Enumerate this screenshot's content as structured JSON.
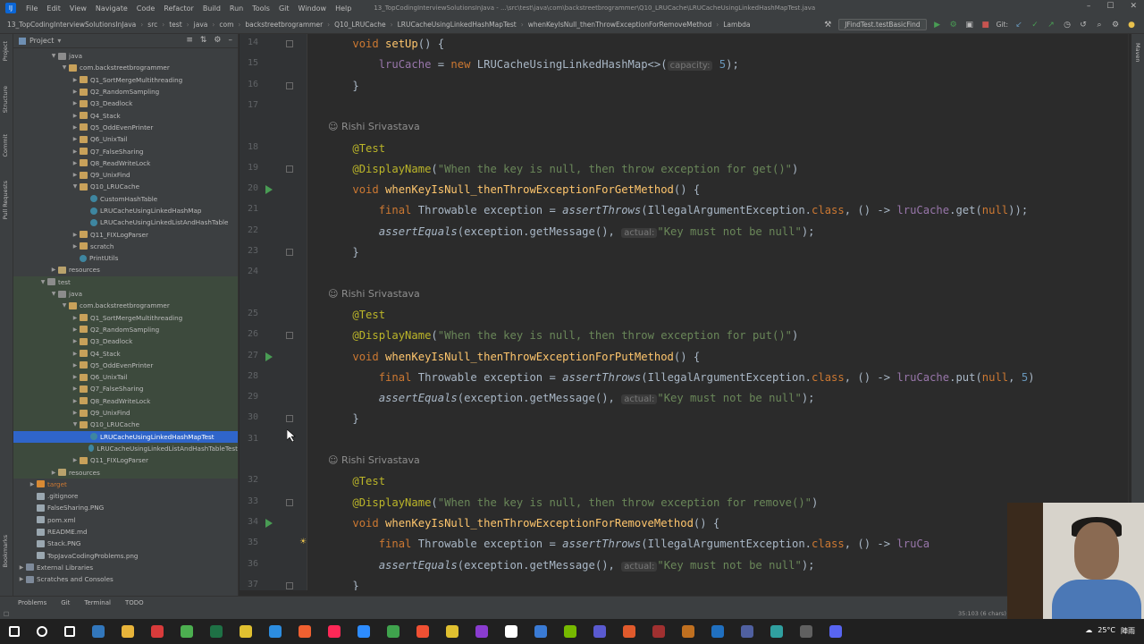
{
  "app": {
    "menu": [
      "File",
      "Edit",
      "View",
      "Navigate",
      "Code",
      "Refactor",
      "Build",
      "Run",
      "Tools",
      "Git",
      "Window",
      "Help"
    ],
    "window_title": "13_TopCodingInterviewSolutionsInJava - ...\\src\\test\\java\\com\\backstreetbrogrammer\\Q10_LRUCache\\LRUCacheUsingLinkedHashMapTest.java"
  },
  "breadcrumbs": [
    "13_TopCodingInterviewSolutionsInJava",
    "src",
    "test",
    "java",
    "com",
    "backstreetbrogrammer",
    "Q10_LRUCache",
    "LRUCacheUsingLinkedHashMapTest",
    "whenKeyIsNull_thenThrowExceptionForRemoveMethod",
    "Lambda"
  ],
  "run_config": "JFindTest.testBasicFind",
  "git_label": "Git:",
  "project_panel": {
    "title": "Project",
    "tree": [
      {
        "label": "java",
        "depth": 3,
        "kind": "folder",
        "state": "open",
        "tint": ""
      },
      {
        "label": "com.backstreetbrogrammer",
        "depth": 4,
        "kind": "pkg",
        "state": "open",
        "tint": ""
      },
      {
        "label": "Q1_SortMergeMultithreading",
        "depth": 5,
        "kind": "pkg",
        "state": "closed",
        "tint": ""
      },
      {
        "label": "Q2_RandomSampling",
        "depth": 5,
        "kind": "pkg",
        "state": "closed",
        "tint": ""
      },
      {
        "label": "Q3_Deadlock",
        "depth": 5,
        "kind": "pkg",
        "state": "closed",
        "tint": ""
      },
      {
        "label": "Q4_Stack",
        "depth": 5,
        "kind": "pkg",
        "state": "closed",
        "tint": ""
      },
      {
        "label": "Q5_OddEvenPrinter",
        "depth": 5,
        "kind": "pkg",
        "state": "closed",
        "tint": ""
      },
      {
        "label": "Q6_UnixTail",
        "depth": 5,
        "kind": "pkg",
        "state": "closed",
        "tint": ""
      },
      {
        "label": "Q7_FalseSharing",
        "depth": 5,
        "kind": "pkg",
        "state": "closed",
        "tint": ""
      },
      {
        "label": "Q8_ReadWriteLock",
        "depth": 5,
        "kind": "pkg",
        "state": "closed",
        "tint": ""
      },
      {
        "label": "Q9_UnixFind",
        "depth": 5,
        "kind": "pkg",
        "state": "closed",
        "tint": ""
      },
      {
        "label": "Q10_LRUCache",
        "depth": 5,
        "kind": "pkg",
        "state": "open",
        "tint": ""
      },
      {
        "label": "CustomHashTable",
        "depth": 6,
        "kind": "cls",
        "state": "",
        "tint": ""
      },
      {
        "label": "LRUCacheUsingLinkedHashMap",
        "depth": 6,
        "kind": "cls",
        "state": "",
        "tint": ""
      },
      {
        "label": "LRUCacheUsingLinkedListAndHashTable",
        "depth": 6,
        "kind": "cls",
        "state": "",
        "tint": ""
      },
      {
        "label": "Q11_FIXLogParser",
        "depth": 5,
        "kind": "pkg",
        "state": "closed",
        "tint": ""
      },
      {
        "label": "scratch",
        "depth": 5,
        "kind": "pkg",
        "state": "closed",
        "tint": ""
      },
      {
        "label": "PrintUtils",
        "depth": 5,
        "kind": "cls",
        "state": "",
        "tint": ""
      },
      {
        "label": "resources",
        "depth": 3,
        "kind": "res",
        "state": "closed",
        "tint": ""
      },
      {
        "label": "test",
        "depth": 2,
        "kind": "folder",
        "state": "open",
        "tint": "green"
      },
      {
        "label": "java",
        "depth": 3,
        "kind": "folder",
        "state": "open",
        "tint": "green"
      },
      {
        "label": "com.backstreetbrogrammer",
        "depth": 4,
        "kind": "pkg",
        "state": "open",
        "tint": "green"
      },
      {
        "label": "Q1_SortMergeMultithreading",
        "depth": 5,
        "kind": "pkg",
        "state": "closed",
        "tint": "green"
      },
      {
        "label": "Q2_RandomSampling",
        "depth": 5,
        "kind": "pkg",
        "state": "closed",
        "tint": "green"
      },
      {
        "label": "Q3_Deadlock",
        "depth": 5,
        "kind": "pkg",
        "state": "closed",
        "tint": "green"
      },
      {
        "label": "Q4_Stack",
        "depth": 5,
        "kind": "pkg",
        "state": "closed",
        "tint": "green"
      },
      {
        "label": "Q5_OddEvenPrinter",
        "depth": 5,
        "kind": "pkg",
        "state": "closed",
        "tint": "green"
      },
      {
        "label": "Q6_UnixTail",
        "depth": 5,
        "kind": "pkg",
        "state": "closed",
        "tint": "green"
      },
      {
        "label": "Q7_FalseSharing",
        "depth": 5,
        "kind": "pkg",
        "state": "closed",
        "tint": "green"
      },
      {
        "label": "Q8_ReadWriteLock",
        "depth": 5,
        "kind": "pkg",
        "state": "closed",
        "tint": "green"
      },
      {
        "label": "Q9_UnixFind",
        "depth": 5,
        "kind": "pkg",
        "state": "closed",
        "tint": "green"
      },
      {
        "label": "Q10_LRUCache",
        "depth": 5,
        "kind": "pkg",
        "state": "open",
        "tint": "green"
      },
      {
        "label": "LRUCacheUsingLinkedHashMapTest",
        "depth": 6,
        "kind": "cls",
        "state": "",
        "tint": "selected"
      },
      {
        "label": "LRUCacheUsingLinkedListAndHashTableTest",
        "depth": 6,
        "kind": "cls",
        "state": "",
        "tint": "green"
      },
      {
        "label": "Q11_FIXLogParser",
        "depth": 5,
        "kind": "pkg",
        "state": "closed",
        "tint": "green"
      },
      {
        "label": "resources",
        "depth": 3,
        "kind": "res",
        "state": "closed",
        "tint": "green"
      },
      {
        "label": "target",
        "depth": 1,
        "kind": "target",
        "state": "closed",
        "tint": "target"
      },
      {
        "label": ".gitignore",
        "depth": 1,
        "kind": "file",
        "state": "",
        "tint": ""
      },
      {
        "label": "FalseSharing.PNG",
        "depth": 1,
        "kind": "file",
        "state": "",
        "tint": ""
      },
      {
        "label": "pom.xml",
        "depth": 1,
        "kind": "file",
        "state": "",
        "tint": ""
      },
      {
        "label": "README.md",
        "depth": 1,
        "kind": "file",
        "state": "",
        "tint": ""
      },
      {
        "label": "Stack.PNG",
        "depth": 1,
        "kind": "file",
        "state": "",
        "tint": ""
      },
      {
        "label": "TopJavaCodingProblems.png",
        "depth": 1,
        "kind": "file",
        "state": "",
        "tint": ""
      },
      {
        "label": "External Libraries",
        "depth": 0,
        "kind": "lib",
        "state": "closed",
        "tint": ""
      },
      {
        "label": "Scratches and Consoles",
        "depth": 0,
        "kind": "lib",
        "state": "closed",
        "tint": ""
      }
    ]
  },
  "editor": {
    "lines": [
      {
        "n": "14",
        "run": false,
        "fold": true,
        "bulb": false,
        "author": "",
        "tokens": [
          [
            "    ",
            ""
          ],
          [
            "void ",
            "kw"
          ],
          [
            "setUp",
            "fn"
          ],
          [
            "() {",
            ""
          ]
        ]
      },
      {
        "n": "15",
        "run": false,
        "fold": false,
        "bulb": false,
        "author": "",
        "tokens": [
          [
            "        ",
            ""
          ],
          [
            "lruCache",
            "fld"
          ],
          [
            " = ",
            ""
          ],
          [
            "new ",
            "kw"
          ],
          [
            "LRUCacheUsingLinkedHashMap<>(",
            ""
          ],
          [
            "capacity:",
            "hint"
          ],
          [
            " 5",
            "num"
          ],
          [
            ");",
            ""
          ]
        ]
      },
      {
        "n": "16",
        "run": false,
        "fold": true,
        "bulb": false,
        "author": "",
        "tokens": [
          [
            "    }",
            ""
          ]
        ]
      },
      {
        "n": "17",
        "run": false,
        "fold": false,
        "bulb": false,
        "author": "",
        "tokens": []
      },
      {
        "n": "",
        "run": false,
        "fold": false,
        "bulb": false,
        "author": "Rishi Srivastava",
        "tokens": []
      },
      {
        "n": "18",
        "run": false,
        "fold": false,
        "bulb": false,
        "author": "",
        "tokens": [
          [
            "    ",
            ""
          ],
          [
            "@Test",
            "ann"
          ]
        ]
      },
      {
        "n": "19",
        "run": false,
        "fold": true,
        "bulb": false,
        "author": "",
        "tokens": [
          [
            "    ",
            ""
          ],
          [
            "@DisplayName",
            "ann"
          ],
          [
            "(",
            ""
          ],
          [
            "\"When the key is null, then throw exception for get()\"",
            "str"
          ],
          [
            ")",
            ""
          ]
        ]
      },
      {
        "n": "20",
        "run": true,
        "fold": false,
        "bulb": false,
        "author": "",
        "tokens": [
          [
            "    ",
            ""
          ],
          [
            "void ",
            "kw"
          ],
          [
            "whenKeyIsNull_thenThrowExceptionForGetMethod",
            "fn"
          ],
          [
            "() {",
            ""
          ]
        ]
      },
      {
        "n": "21",
        "run": false,
        "fold": false,
        "bulb": false,
        "author": "",
        "tokens": [
          [
            "        ",
            ""
          ],
          [
            "final ",
            "kw"
          ],
          [
            "Throwable exception = ",
            ""
          ],
          [
            "assertThrows",
            "it"
          ],
          [
            "(IllegalArgumentException.",
            ""
          ],
          [
            "class",
            "kw"
          ],
          [
            ", () -> ",
            ""
          ],
          [
            "lruCache",
            "fld"
          ],
          [
            ".get(",
            ""
          ],
          [
            "null",
            "kw"
          ],
          [
            "));",
            ""
          ]
        ]
      },
      {
        "n": "22",
        "run": false,
        "fold": false,
        "bulb": false,
        "author": "",
        "tokens": [
          [
            "        ",
            ""
          ],
          [
            "assertEquals",
            "it"
          ],
          [
            "(exception.getMessage(), ",
            ""
          ],
          [
            "actual:",
            "hint"
          ],
          [
            "\"Key must not be null\"",
            "str"
          ],
          [
            ");",
            ""
          ]
        ]
      },
      {
        "n": "23",
        "run": false,
        "fold": true,
        "bulb": false,
        "author": "",
        "tokens": [
          [
            "    }",
            ""
          ]
        ]
      },
      {
        "n": "24",
        "run": false,
        "fold": false,
        "bulb": false,
        "author": "",
        "tokens": []
      },
      {
        "n": "",
        "run": false,
        "fold": false,
        "bulb": false,
        "author": "Rishi Srivastava",
        "tokens": []
      },
      {
        "n": "25",
        "run": false,
        "fold": false,
        "bulb": false,
        "author": "",
        "tokens": [
          [
            "    ",
            ""
          ],
          [
            "@Test",
            "ann"
          ]
        ]
      },
      {
        "n": "26",
        "run": false,
        "fold": true,
        "bulb": false,
        "author": "",
        "tokens": [
          [
            "    ",
            ""
          ],
          [
            "@DisplayName",
            "ann"
          ],
          [
            "(",
            ""
          ],
          [
            "\"When the key is null, then throw exception for put()\"",
            "str"
          ],
          [
            ")",
            ""
          ]
        ]
      },
      {
        "n": "27",
        "run": true,
        "fold": false,
        "bulb": false,
        "author": "",
        "tokens": [
          [
            "    ",
            ""
          ],
          [
            "void ",
            "kw"
          ],
          [
            "whenKeyIsNull_thenThrowExceptionForPutMethod",
            "fn"
          ],
          [
            "() {",
            ""
          ]
        ]
      },
      {
        "n": "28",
        "run": false,
        "fold": false,
        "bulb": false,
        "author": "",
        "tokens": [
          [
            "        ",
            ""
          ],
          [
            "final ",
            "kw"
          ],
          [
            "Throwable exception = ",
            ""
          ],
          [
            "assertThrows",
            "it"
          ],
          [
            "(IllegalArgumentException.",
            ""
          ],
          [
            "class",
            "kw"
          ],
          [
            ", () -> ",
            ""
          ],
          [
            "lruCache",
            "fld"
          ],
          [
            ".put(",
            ""
          ],
          [
            "null",
            "kw"
          ],
          [
            ", ",
            ""
          ],
          [
            "5",
            "num"
          ],
          [
            ")",
            ""
          ]
        ]
      },
      {
        "n": "29",
        "run": false,
        "fold": false,
        "bulb": false,
        "author": "",
        "tokens": [
          [
            "        ",
            ""
          ],
          [
            "assertEquals",
            "it"
          ],
          [
            "(exception.getMessage(), ",
            ""
          ],
          [
            "actual:",
            "hint"
          ],
          [
            "\"Key must not be null\"",
            "str"
          ],
          [
            ");",
            ""
          ]
        ]
      },
      {
        "n": "30",
        "run": false,
        "fold": true,
        "bulb": false,
        "author": "",
        "tokens": [
          [
            "    }",
            ""
          ]
        ]
      },
      {
        "n": "31",
        "run": false,
        "fold": false,
        "bulb": false,
        "author": "",
        "tokens": []
      },
      {
        "n": "",
        "run": false,
        "fold": false,
        "bulb": false,
        "author": "Rishi Srivastava",
        "tokens": []
      },
      {
        "n": "32",
        "run": false,
        "fold": false,
        "bulb": false,
        "author": "",
        "tokens": [
          [
            "    ",
            ""
          ],
          [
            "@Test",
            "ann"
          ]
        ]
      },
      {
        "n": "33",
        "run": false,
        "fold": true,
        "bulb": false,
        "author": "",
        "tokens": [
          [
            "    ",
            ""
          ],
          [
            "@DisplayName",
            "ann"
          ],
          [
            "(",
            ""
          ],
          [
            "\"When the key is null, then throw exception for remove()\"",
            "str"
          ],
          [
            ")",
            ""
          ]
        ]
      },
      {
        "n": "34",
        "run": true,
        "fold": false,
        "bulb": false,
        "author": "",
        "tokens": [
          [
            "    ",
            ""
          ],
          [
            "void ",
            "kw"
          ],
          [
            "whenKeyIsNull_thenThrowExceptionForRemoveMethod",
            "fn"
          ],
          [
            "() {",
            ""
          ]
        ]
      },
      {
        "n": "35",
        "run": false,
        "fold": false,
        "bulb": true,
        "author": "",
        "tokens": [
          [
            "        ",
            ""
          ],
          [
            "final ",
            "kw"
          ],
          [
            "Throwable exception = ",
            ""
          ],
          [
            "assertThrows",
            "it"
          ],
          [
            "(IllegalArgumentException.",
            ""
          ],
          [
            "class",
            "kw"
          ],
          [
            ", () -> ",
            ""
          ],
          [
            "lruCa",
            "fld"
          ]
        ]
      },
      {
        "n": "36",
        "run": false,
        "fold": false,
        "bulb": false,
        "author": "",
        "tokens": [
          [
            "        ",
            ""
          ],
          [
            "assertEquals",
            "it"
          ],
          [
            "(exception.getMessage(), ",
            ""
          ],
          [
            "actual:",
            "hint"
          ],
          [
            "\"Key must not be null\"",
            "str"
          ],
          [
            ");",
            ""
          ]
        ]
      },
      {
        "n": "37",
        "run": false,
        "fold": true,
        "bulb": false,
        "author": "",
        "tokens": [
          [
            "    }",
            ""
          ]
        ]
      }
    ]
  },
  "bottom_tabs": [
    "Problems",
    "Git",
    "Terminal",
    "TODO"
  ],
  "status": {
    "position": "35:103 (6 chars)"
  },
  "tray": {
    "weather": "25°C",
    "location": "陣雨"
  },
  "taskbar_icons": [
    "start",
    "search",
    "task-view",
    "edge",
    "explorer",
    "pdf",
    "chrome",
    "excel",
    "app1",
    "vscode",
    "brave",
    "intellij",
    "zoom",
    "evernote",
    "git",
    "ship",
    "app2",
    "github",
    "app3",
    "nvidia",
    "app4",
    "app5",
    "app6",
    "app7",
    "app8",
    "app9",
    "app10",
    "app11",
    "discord"
  ]
}
